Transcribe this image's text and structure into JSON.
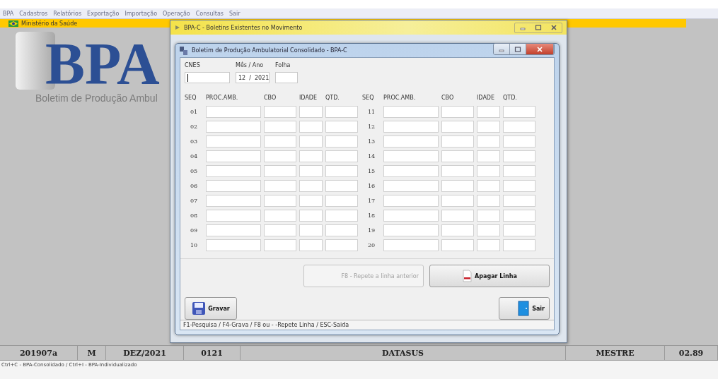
{
  "menu_bar": {
    "items": [
      "BPA",
      "Cadastros",
      "Relatórios",
      "Exportação",
      "Importação",
      "Operação",
      "Consultas",
      "Sair"
    ]
  },
  "header_bar": {
    "title": "Ministério da Saúde"
  },
  "background": {
    "logo": "BPA",
    "subtitle": "Boletim de Produção Ambul"
  },
  "outer_window": {
    "title": "BPA-C - Boletins Existentes no Movimento"
  },
  "form_window": {
    "title": "Boletim de Produção Ambulatorial Consolidado - BPA-C",
    "cnes": {
      "label": "CNES"
    },
    "month_year": {
      "label": "Mês / Ano",
      "month": "12",
      "separator": "/",
      "year": "2021"
    },
    "folha": {
      "label": "Folha"
    },
    "left_columns": [
      "SEQ",
      "PROC.AMB.",
      "CBO",
      "IDADE",
      "QTD."
    ],
    "right_columns": [
      "SEQ",
      "PROC.AMB.",
      "CBO",
      "IDADE",
      "QTD."
    ],
    "left_rows": [
      "01",
      "02",
      "03",
      "04",
      "05",
      "06",
      "07",
      "08",
      "09",
      "10"
    ],
    "right_rows": [
      "11",
      "12",
      "13",
      "14",
      "15",
      "16",
      "17",
      "18",
      "19",
      "20"
    ],
    "line_buttons": [
      {
        "kind": "repeat",
        "label": "F8 - Repete a linha anterior",
        "disabled": true
      },
      {
        "kind": "delete",
        "label": "Apagar Linha",
        "disabled": false
      }
    ],
    "save_button": {
      "label": "Gravar"
    },
    "exit_button": {
      "label": "Sair"
    },
    "shortcuts": "F1-Pesquisa /  F4-Grava / F8 ou - -Repete Linha  / ESC-Saida"
  },
  "status_bar": [
    "201907a",
    "M",
    "DEZ/2021",
    "0121",
    "DATASUS",
    "MESTRE",
    "02.89"
  ],
  "footer_hint": "Ctrl+C - BPA-Consolidado / Ctrl+I - BPA-Individualizado"
}
